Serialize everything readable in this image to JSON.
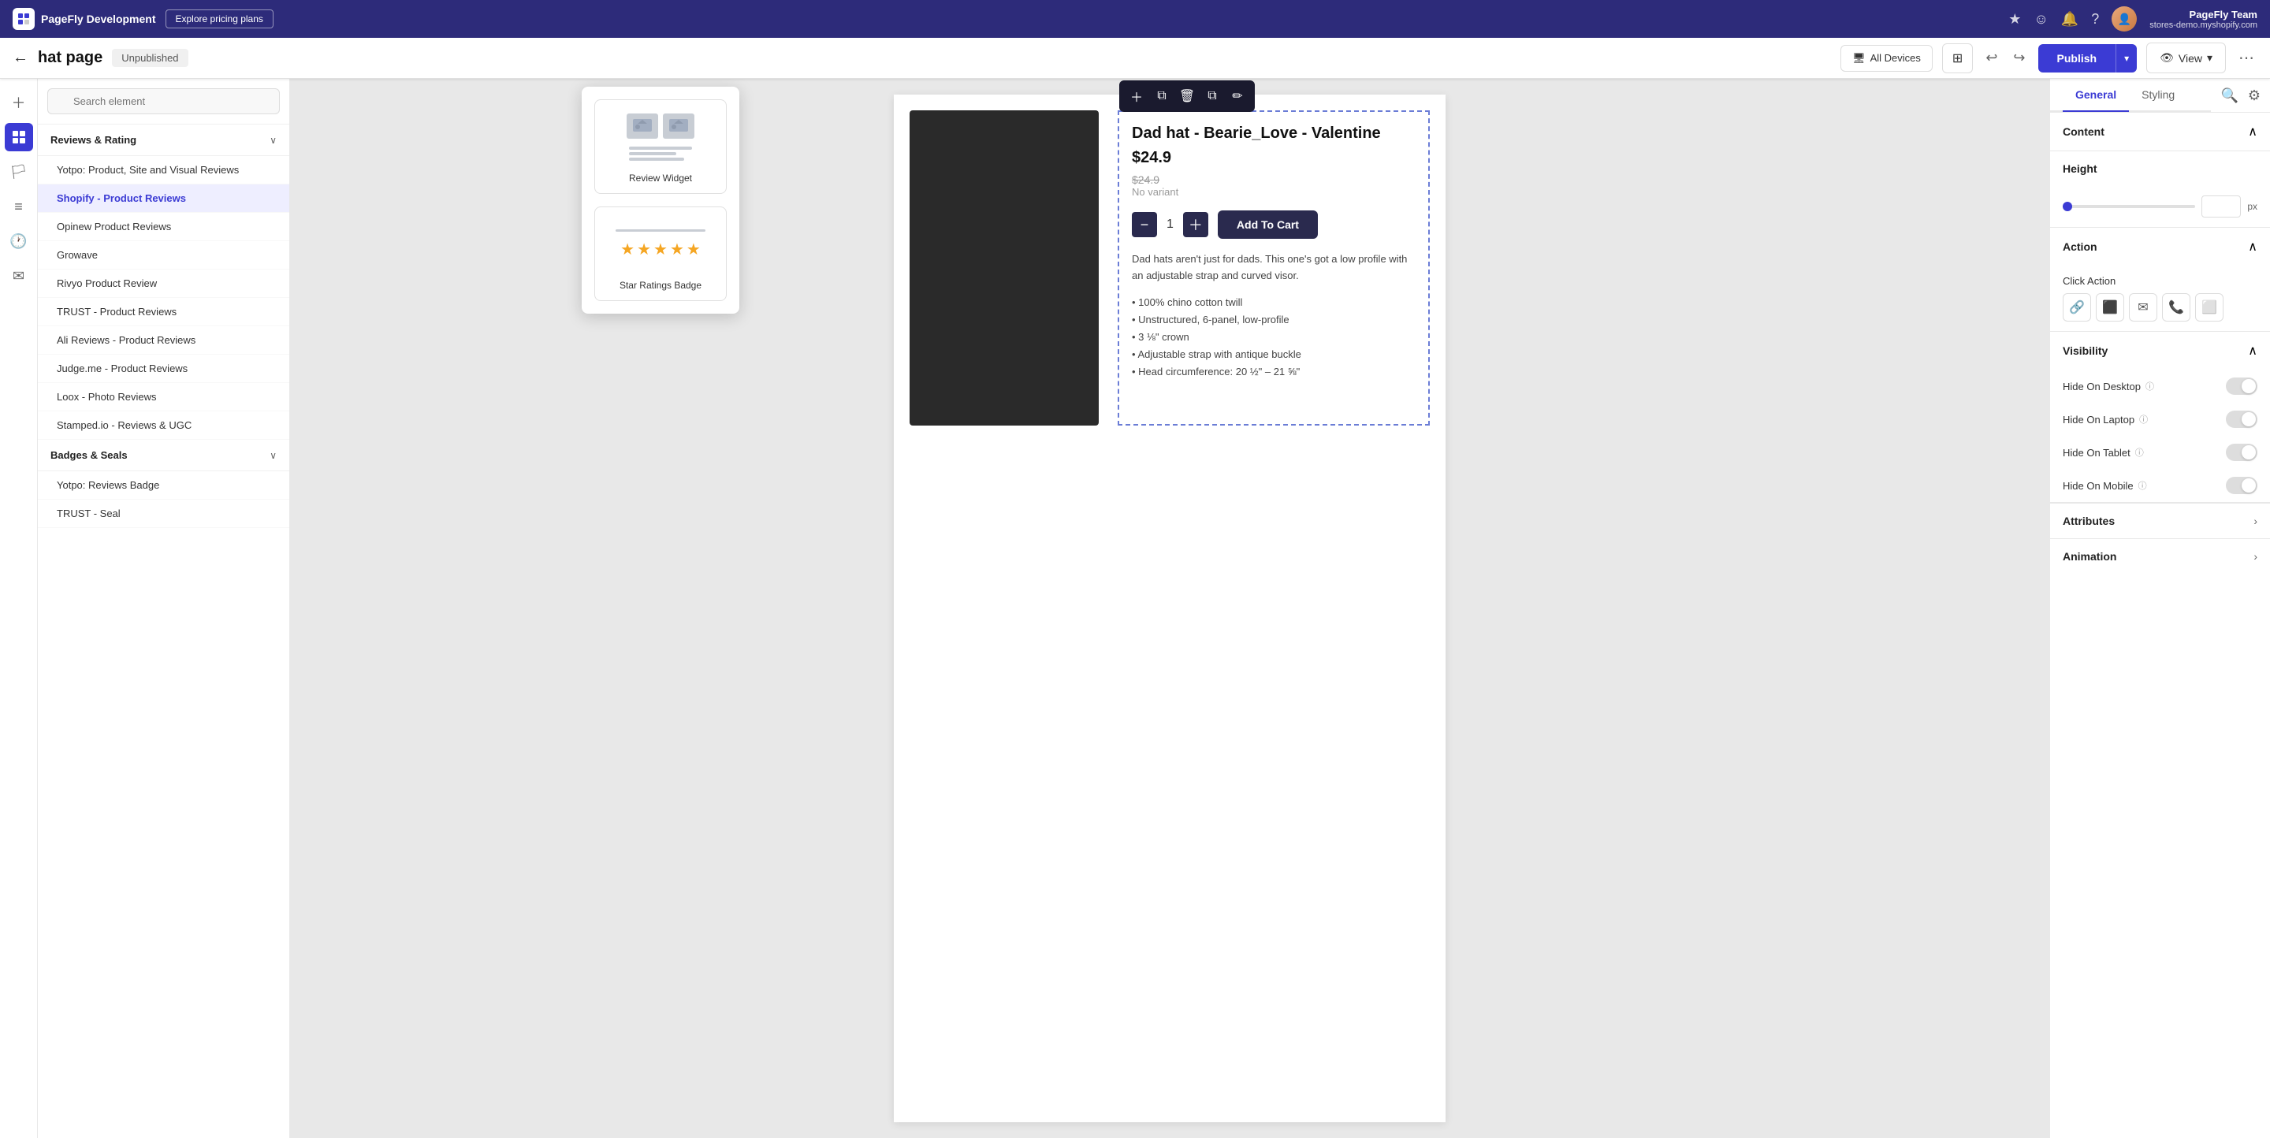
{
  "topNav": {
    "brand": "PageFly Development",
    "explorePlansLabel": "Explore pricing plans",
    "navIconStar": "★",
    "navIconSmile": "☺",
    "navIconBell": "🔔",
    "navIconHelp": "?",
    "userAvatar": "👤",
    "userName": "PageFly Team",
    "userStore": "stores-demo.myshopify.com"
  },
  "secondBar": {
    "backIcon": "←",
    "pageTitle": "hat page",
    "statusBadge": "Unpublished",
    "deviceLabel": "All Devices",
    "gridIcon": "⊞",
    "undoIcon": "↩",
    "redoIcon": "↪",
    "publishLabel": "Publish",
    "publishChevron": "▾",
    "viewLabel": "View",
    "viewChevron": "▾",
    "moreIcon": "⋯"
  },
  "sidebarIcons": [
    {
      "icon": "＋",
      "name": "add-icon",
      "active": false
    },
    {
      "icon": "⬛",
      "name": "elements-icon",
      "active": true
    },
    {
      "icon": "🏔",
      "name": "pages-icon",
      "active": false
    },
    {
      "icon": "≡",
      "name": "layers-icon",
      "active": false
    },
    {
      "icon": "🕐",
      "name": "history-icon",
      "active": false
    },
    {
      "icon": "✉",
      "name": "inbox-icon",
      "active": false
    }
  ],
  "elementPanel": {
    "searchPlaceholder": "Search element",
    "sections": [
      {
        "label": "Reviews & Rating",
        "expanded": true,
        "items": [
          {
            "label": "Yotpo: Product, Site and Visual Reviews",
            "active": false
          },
          {
            "label": "Shopify - Product Reviews",
            "active": true
          },
          {
            "label": "Opinew Product Reviews",
            "active": false
          },
          {
            "label": "Growave",
            "active": false
          },
          {
            "label": "Rivyo Product Review",
            "active": false
          },
          {
            "label": "TRUST - Product Reviews",
            "active": false
          },
          {
            "label": "Ali Reviews - Product Reviews",
            "active": false
          },
          {
            "label": "Judge.me - Product Reviews",
            "active": false
          },
          {
            "label": "Loox - Photo Reviews",
            "active": false
          },
          {
            "label": "Stamped.io - Reviews & UGC",
            "active": false
          }
        ]
      },
      {
        "label": "Badges & Seals",
        "expanded": true,
        "items": [
          {
            "label": "Yotpo: Reviews Badge",
            "active": false
          },
          {
            "label": "TRUST - Seal",
            "active": false
          }
        ]
      }
    ]
  },
  "widgetPopup": {
    "widgets": [
      {
        "id": "review-widget",
        "label": "Review Widget"
      },
      {
        "id": "star-ratings-badge",
        "label": "Star Ratings Badge"
      }
    ]
  },
  "product": {
    "title": "Dad hat - Bearie_Love - Valentine",
    "price": "$24.9",
    "originalPrice": "$24.9",
    "variantLabel": "No variant",
    "qty": "1",
    "addToCartLabel": "Add To Cart",
    "description": "Dad hats aren't just for dads. This one's got a low profile with an adjustable strap and curved visor.",
    "bullets": [
      "100% chino cotton twill",
      "Unstructured, 6-panel, low-profile",
      "3 ⅛\" crown",
      "Adjustable strap with antique buckle",
      "Head circumference: 20 ½\" – 21 ⅝\""
    ]
  },
  "rightPanel": {
    "tabs": [
      {
        "label": "General",
        "active": true
      },
      {
        "label": "Styling",
        "active": false
      }
    ],
    "searchIcon": "🔍",
    "settingsIcon": "⚙",
    "sections": {
      "content": {
        "label": "Content",
        "chevron": "∧"
      },
      "height": {
        "label": "Height",
        "sliderValue": "",
        "unit": "px"
      },
      "action": {
        "label": "Action",
        "chevron": "∧",
        "clickActionLabel": "Click Action",
        "buttons": [
          "🔗",
          "⬛",
          "✉",
          "🔗",
          "⬜"
        ]
      },
      "visibility": {
        "label": "Visibility",
        "chevron": "∧",
        "items": [
          {
            "label": "Hide On Desktop",
            "hasInfo": true,
            "enabled": false
          },
          {
            "label": "Hide On Laptop",
            "hasInfo": true,
            "enabled": false
          },
          {
            "label": "Hide On Tablet",
            "hasInfo": true,
            "enabled": false
          },
          {
            "label": "Hide On Mobile",
            "hasInfo": true,
            "enabled": false
          }
        ]
      },
      "attributes": {
        "label": "Attributes",
        "chevron": ">"
      },
      "animation": {
        "label": "Animation",
        "chevron": ">"
      }
    }
  }
}
